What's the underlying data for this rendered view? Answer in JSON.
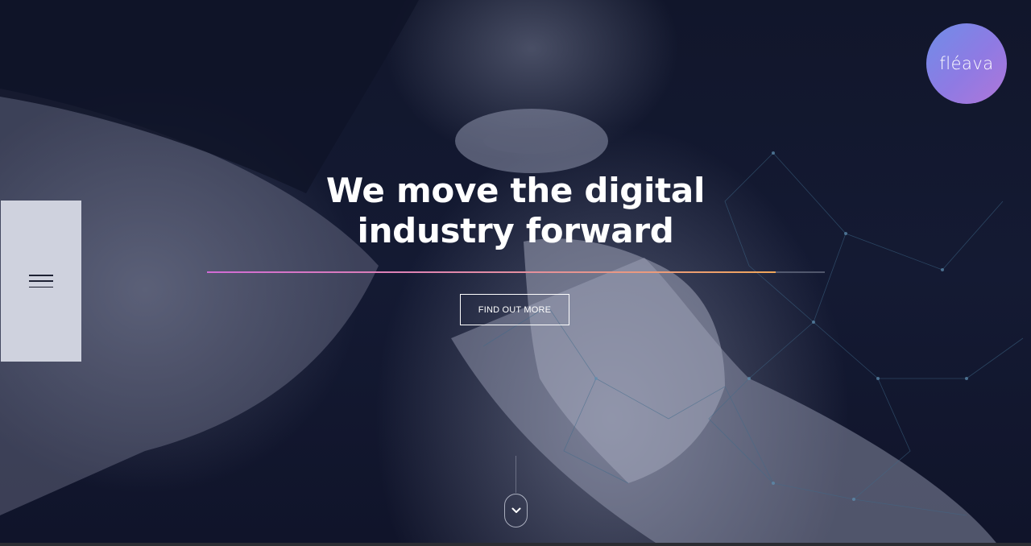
{
  "brand": {
    "logo_text": "fléava",
    "accent_gradient": [
      "#6f8de8",
      "#b077d9"
    ]
  },
  "nav": {
    "menu_icon": "hamburger-menu-icon"
  },
  "hero": {
    "headline_line1": "We move the digital",
    "headline_line2": "industry forward",
    "progress_fraction": 0.92,
    "progress_colors": [
      "#d16bd6",
      "#f0a65a"
    ],
    "cta_label": "FIND OUT MORE",
    "scroll_icon": "chevron-down-icon"
  }
}
